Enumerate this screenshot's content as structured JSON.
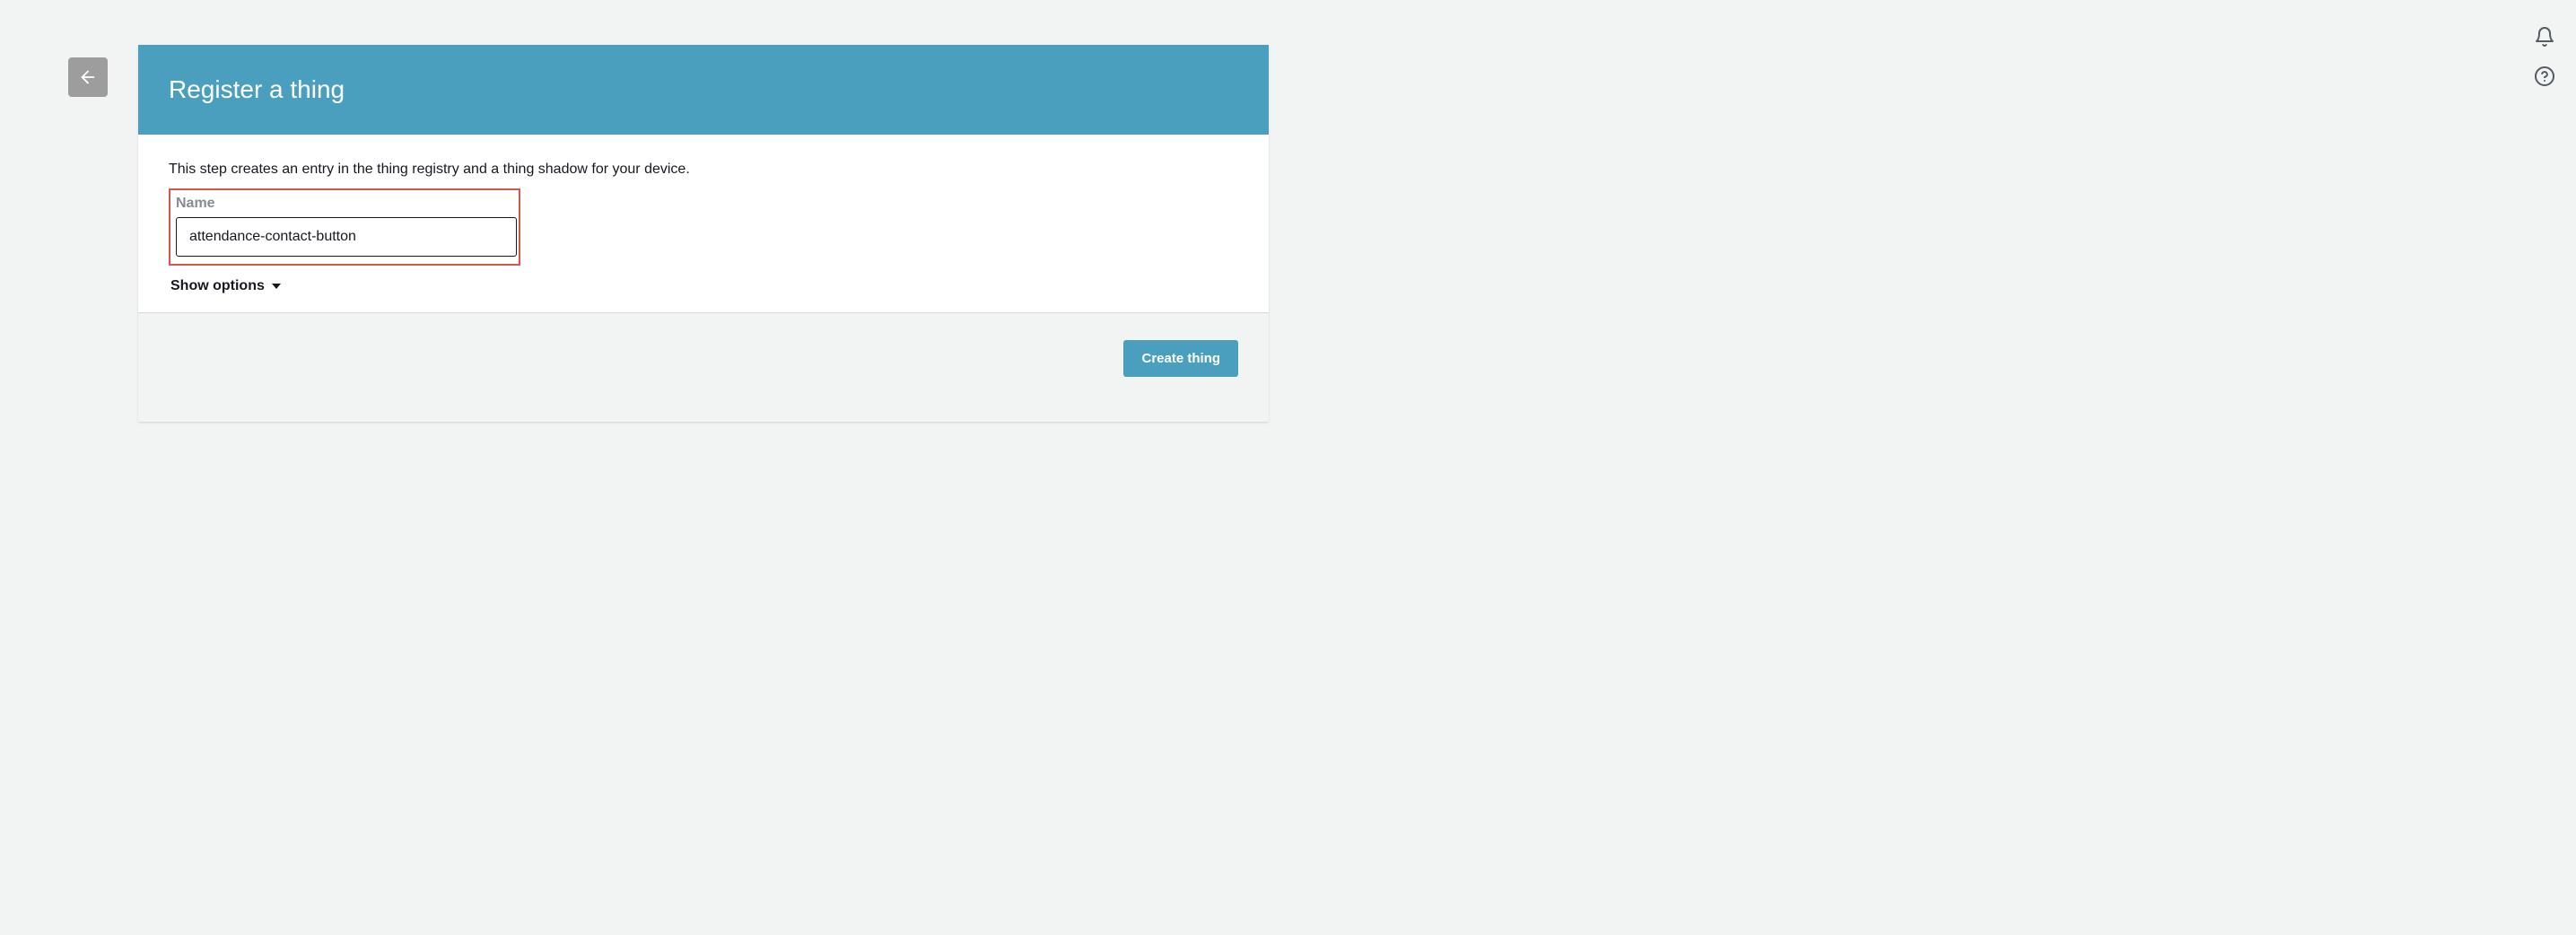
{
  "header": {
    "title": "Register a thing"
  },
  "body": {
    "description": "This step creates an entry in the thing registry and a thing shadow for your device.",
    "name_label": "Name",
    "name_value": "attendance-contact-button",
    "show_options_label": "Show options"
  },
  "footer": {
    "create_button_label": "Create thing"
  },
  "icons": {
    "back": "back-arrow-icon",
    "bell": "notifications-icon",
    "help": "help-icon",
    "caret": "caret-down-icon"
  }
}
